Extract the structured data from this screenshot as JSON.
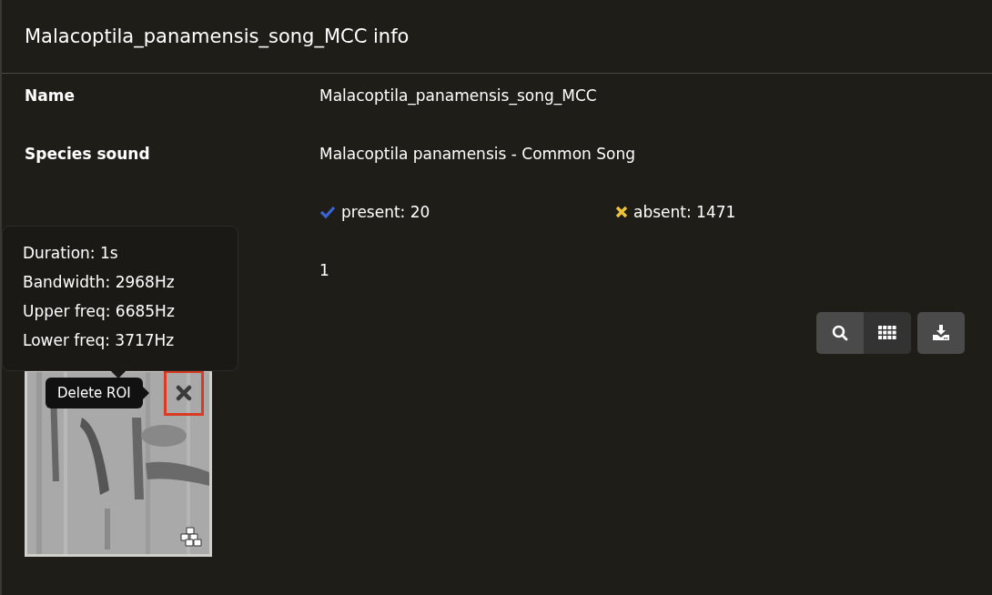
{
  "title": "Malacoptila_panamensis_song_MCC info",
  "rows": [
    {
      "kind": "text",
      "label": "Name",
      "value": "Malacoptila_panamensis_song_MCC"
    },
    {
      "kind": "text",
      "label": "Species sound",
      "value": "Malacoptila panamensis - Common Song"
    },
    {
      "kind": "counts",
      "present": "present: 20",
      "absent": "absent: 1471"
    },
    {
      "kind": "text",
      "value": "1"
    }
  ],
  "view_toggle": [
    {
      "kind": "search",
      "selected": false
    },
    {
      "kind": "grid",
      "selected": true
    }
  ],
  "roi": {
    "kind": "picture",
    "delete_tooltip": "Delete ROI",
    "highlighted": true
  },
  "info_tooltip": [
    "Duration: 1s",
    "Bandwidth: 2968Hz",
    "Upper freq: 6685Hz",
    "Lower freq: 3717Hz"
  ]
}
